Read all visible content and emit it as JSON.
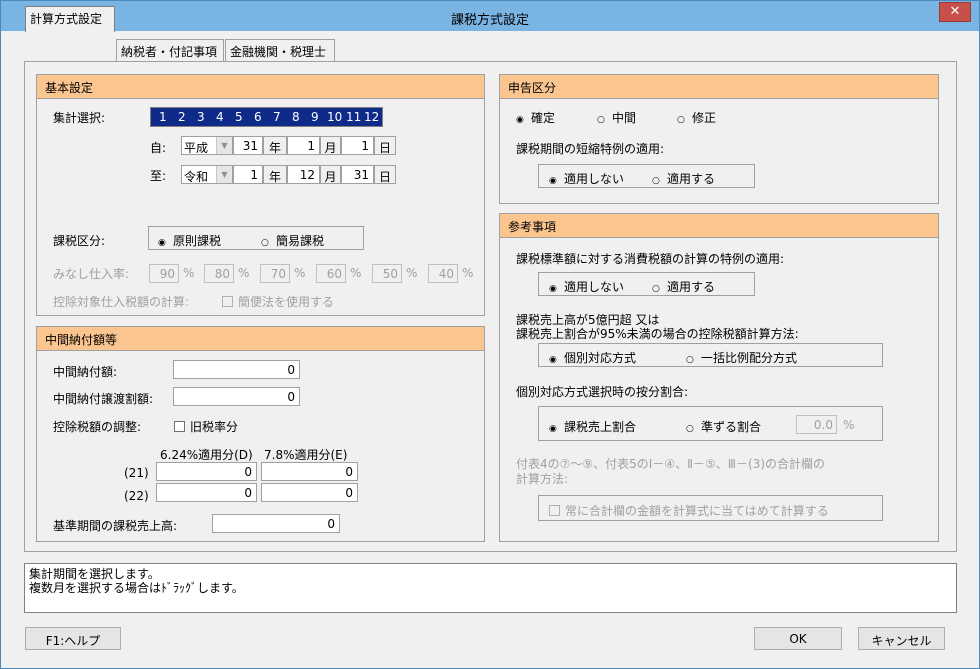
{
  "window": {
    "title": "課税方式設定",
    "close_glyph": "✕"
  },
  "tabs": [
    "計算方式設定",
    "納税者・付記事項",
    "金融機関・税理士"
  ],
  "basic": {
    "header": "基本設定",
    "aggregation_label": "集計選択:",
    "months": [
      "1",
      "2",
      "3",
      "4",
      "5",
      "6",
      "7",
      "8",
      "9",
      "10",
      "11",
      "12"
    ],
    "from_label": "自:",
    "to_label": "至:",
    "from": {
      "era": "平成",
      "year": "31",
      "month": "1",
      "day": "1"
    },
    "to": {
      "era": "令和",
      "year": "1",
      "month": "12",
      "day": "31"
    },
    "unit_year": "年",
    "unit_month": "月",
    "unit_day": "日",
    "tax_class_label": "課税区分:",
    "tax_class_options": [
      "原則課税",
      "簡易課税"
    ],
    "deemed_label": "みなし仕入率:",
    "deemed_rates": [
      "90",
      "80",
      "70",
      "60",
      "50",
      "40"
    ],
    "pct": "%",
    "deductible_label": "控除対象仕入税額の計算:",
    "simplified_check": "簡便法を使用する"
  },
  "interim": {
    "header": "中間納付額等",
    "interim_payment_label": "中間納付額:",
    "interim_payment_value": "0",
    "interim_transfer_label": "中間納付譲渡割額:",
    "interim_transfer_value": "0",
    "adjust_label": "控除税額の調整:",
    "old_rate_check": "旧税率分",
    "col_d": "6.24%適用分(D)",
    "col_e": "7.8%適用分(E)",
    "row21": "(21)",
    "row22": "(22)",
    "row21_d": "0",
    "row21_e": "0",
    "row22_d": "0",
    "row22_e": "0",
    "base_sales_label": "基準期間の課税売上高:",
    "base_sales_value": "0"
  },
  "report": {
    "header": "申告区分",
    "options": [
      "確定",
      "中間",
      "修正"
    ],
    "shorten_label": "課税期間の短縮特例の適用:",
    "shorten_options": [
      "適用しない",
      "適用する"
    ]
  },
  "reference": {
    "header": "参考事項",
    "special_label": "課税標準額に対する消費税額の計算の特例の適用:",
    "special_options": [
      "適用しない",
      "適用する"
    ],
    "method_label_1": "課税売上高が5億円超 又は",
    "method_label_2": "課税売上割合が95%未満の場合の控除税額計算方法:",
    "method_options": [
      "個別対応方式",
      "一括比例配分方式"
    ],
    "ratio_label": "個別対応方式選択時の按分割合:",
    "ratio_options": [
      "課税売上割合",
      "準ずる割合"
    ],
    "ratio_value": "0.0",
    "ratio_unit": "%",
    "total_label_1": "付表4の⑦～⑨、付表5のⅠ－④、Ⅱ－⑤、Ⅲ－(3)の合計欄の",
    "total_label_2": "計算方法:",
    "total_check": "常に合計欄の金額を計算式に当てはめて計算する"
  },
  "message": {
    "line1": "集計期間を選択します。",
    "line2": "複数月を選択する場合はﾄﾞﾗｯｸﾞします。"
  },
  "buttons": {
    "help": "F1:ヘルプ",
    "ok": "OK",
    "cancel": "キャンセル"
  },
  "colors": {
    "titlebar": "#7ab4e2",
    "group_header": "#fbc590",
    "month_bar": "#0f2b8a",
    "close": "#c8504a"
  }
}
